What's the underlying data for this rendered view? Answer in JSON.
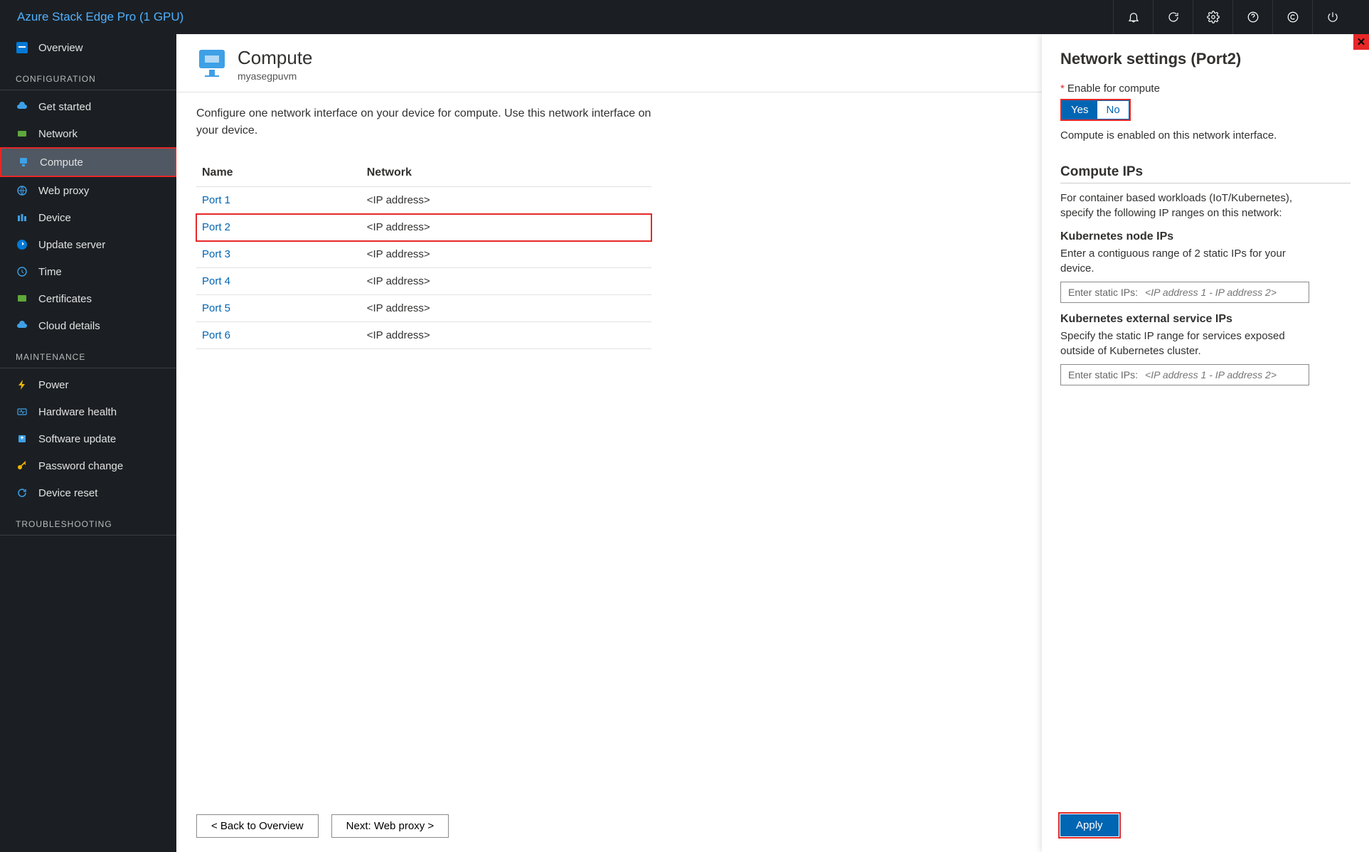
{
  "topbar": {
    "title": "Azure Stack Edge Pro (1 GPU)"
  },
  "sidebar": {
    "items": [
      {
        "label": "Overview",
        "active": false
      },
      {
        "section": "CONFIGURATION"
      },
      {
        "label": "Get started",
        "active": false
      },
      {
        "label": "Network",
        "active": false
      },
      {
        "label": "Compute",
        "active": true
      },
      {
        "label": "Web proxy",
        "active": false
      },
      {
        "label": "Device",
        "active": false
      },
      {
        "label": "Update server",
        "active": false
      },
      {
        "label": "Time",
        "active": false
      },
      {
        "label": "Certificates",
        "active": false
      },
      {
        "label": "Cloud details",
        "active": false
      },
      {
        "section": "MAINTENANCE"
      },
      {
        "label": "Power",
        "active": false
      },
      {
        "label": "Hardware health",
        "active": false
      },
      {
        "label": "Software update",
        "active": false
      },
      {
        "label": "Password change",
        "active": false
      },
      {
        "label": "Device reset",
        "active": false
      },
      {
        "section": "TROUBLESHOOTING"
      }
    ]
  },
  "page": {
    "title": "Compute",
    "subtitle": "myasegpuvm",
    "intro": "Configure one network interface on your device for compute. Use this network interface on your device.",
    "table": {
      "headers": {
        "name": "Name",
        "network": "Network"
      },
      "rows": [
        {
          "name": "Port 1",
          "network": "<IP address>",
          "highlighted": false
        },
        {
          "name": "Port 2",
          "network": "<IP address>",
          "highlighted": true
        },
        {
          "name": "Port 3",
          "network": "<IP address>",
          "highlighted": false
        },
        {
          "name": "Port 4",
          "network": "<IP address>",
          "highlighted": false
        },
        {
          "name": "Port 5",
          "network": "<IP address>",
          "highlighted": false
        },
        {
          "name": "Port 6",
          "network": "<IP address>",
          "highlighted": false
        }
      ]
    },
    "footer": {
      "back": "< Back to Overview",
      "next": "Next: Web proxy >"
    }
  },
  "panel": {
    "title": "Network settings (Port2)",
    "enable_label": "Enable for compute",
    "yes": "Yes",
    "no": "No",
    "status": "Compute is enabled on this network interface.",
    "compute_ips_heading": "Compute IPs",
    "compute_ips_help": "For container based workloads (IoT/Kubernetes), specify the following IP ranges on this network:",
    "k8s_node_heading": "Kubernetes node IPs",
    "k8s_node_help": "Enter a contiguous range of 2 static IPs for your device.",
    "ip_field_label": "Enter static IPs:",
    "ip_field_placeholder": "<IP address 1 - IP address 2>",
    "k8s_ext_heading": "Kubernetes external service IPs",
    "k8s_ext_help": "Specify the static IP range for services exposed outside of Kubernetes cluster.",
    "apply": "Apply"
  }
}
